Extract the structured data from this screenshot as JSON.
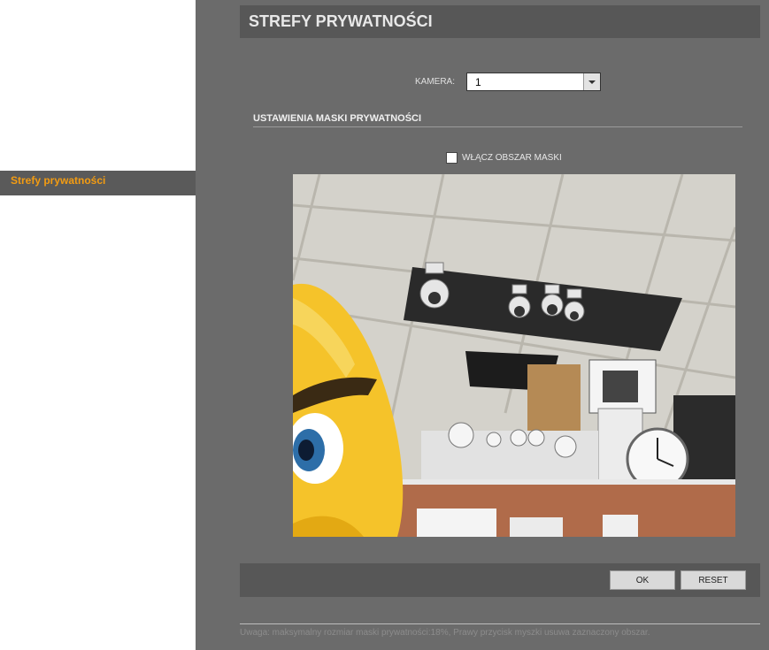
{
  "sidebar": {
    "items": [
      {
        "label": "Strefy prywatności",
        "active": true
      }
    ]
  },
  "header": {
    "title": "STREFY PRYWATNOŚCI"
  },
  "camera": {
    "label": "KAMERA:",
    "selected": "1"
  },
  "mask_settings": {
    "title": "USTAWIENIA MASKI PRYWATNOŚCI",
    "enable_checkbox": {
      "label": "WŁĄCZ OBSZAR MASKI",
      "checked": false
    }
  },
  "buttons": {
    "ok": "OK",
    "reset": "RESET"
  },
  "footer": {
    "note": "Uwaga: maksymalny rozmiar maski prywatności:18%, Prawy przycisk myszki usuwa zaznaczony obszar."
  },
  "colors": {
    "accent": "#f39c12",
    "panel": "#6b6b6b",
    "bar": "#575757"
  }
}
